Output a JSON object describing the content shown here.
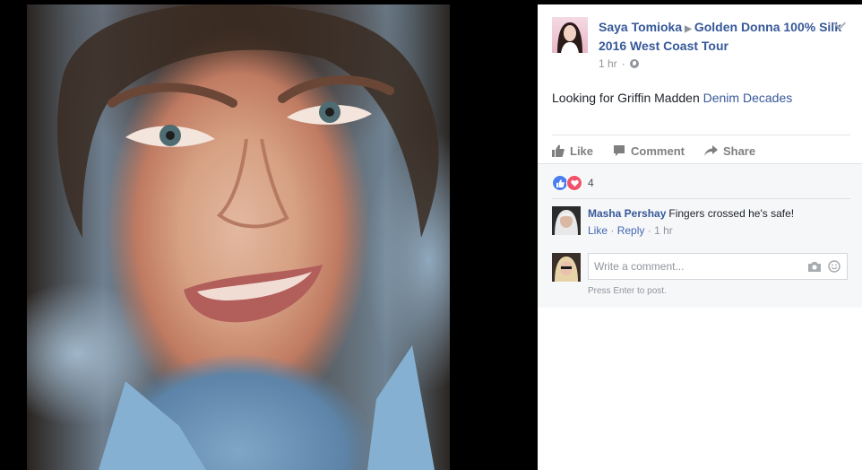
{
  "photo": {
    "alt_icon": "portrait-photo"
  },
  "post": {
    "author": "Saya Tomioka",
    "arrow": "▶",
    "group": "Golden Donna 100% Silk 2016 West Coast Tour",
    "time": "1 hr",
    "text_prefix": "Looking for Griffin Madden",
    "text_link": "Denim Decades"
  },
  "actions": {
    "like": "Like",
    "comment": "Comment",
    "share": "Share"
  },
  "reactions": {
    "count": "4"
  },
  "comment": {
    "author": "Masha Pershay",
    "text": "Fingers crossed he's safe!",
    "like": "Like",
    "reply": "Reply",
    "time": "1 hr",
    "sep": "·"
  },
  "reply_box": {
    "placeholder": "Write a comment...",
    "hint": "Press Enter to post."
  },
  "colors": {
    "link": "#365899",
    "like_blue": "#4a7ef0",
    "love_red": "#f25268"
  }
}
